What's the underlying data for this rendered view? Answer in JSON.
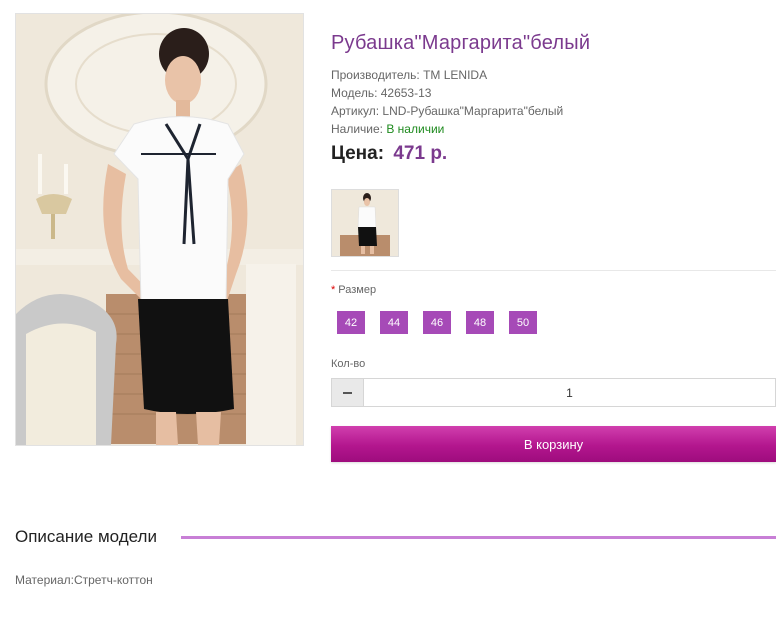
{
  "product": {
    "title": "Рубашка\"Маргарита\"белый",
    "manufacturer": "Производитель: ТМ LENIDA",
    "model": "Модель: 42653-13",
    "article": "Артикул: LND-Рубашка\"Маргарита\"белый",
    "availability_label": "Наличие: ",
    "availability_value": "В наличии",
    "price_label": "Цена:",
    "price_value": "471 р."
  },
  "options": {
    "size_required_mark": "*",
    "size_label": "Размер",
    "sizes": [
      "42",
      "44",
      "46",
      "48",
      "50"
    ]
  },
  "quantity": {
    "label": "Кол-во",
    "value": "1"
  },
  "cart_button": "В корзину",
  "description": {
    "title": "Описание модели",
    "text": "Материал:Стретч-коттон"
  },
  "colors": {
    "accent": "#a64ab7",
    "title": "#7b3a8e",
    "in_stock": "#1e8a1e",
    "cart": "#b3168e"
  }
}
